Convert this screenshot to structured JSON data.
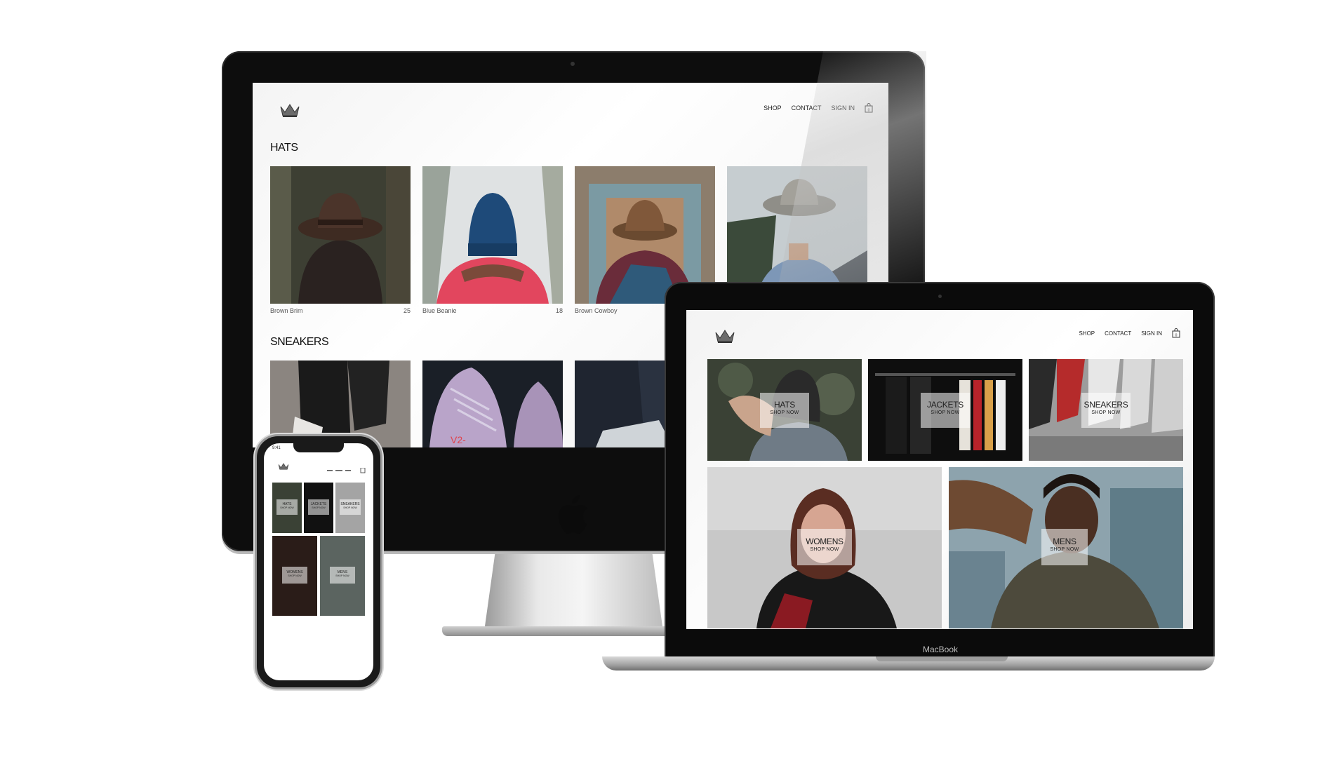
{
  "colors": {
    "accent": "#222222",
    "background": "#ffffff",
    "bezel": "#0d0d0d"
  },
  "imac": {
    "site": {
      "logo_icon": "crown-icon",
      "nav": {
        "shop": "SHOP",
        "contact": "CONTACT",
        "signin": "SIGN IN",
        "cart_icon": "shopping-bag-icon"
      },
      "sections": [
        {
          "title": "HATS",
          "products": [
            {
              "name": "Brown Brim",
              "price": "25"
            },
            {
              "name": "Blue Beanie",
              "price": "18"
            },
            {
              "name": "Brown Cowboy",
              "price": ""
            },
            {
              "name": "",
              "price": ""
            }
          ]
        },
        {
          "title": "SNEAKERS"
        }
      ]
    }
  },
  "macbook": {
    "label": "MacBook",
    "site": {
      "logo_icon": "crown-icon",
      "nav": {
        "shop": "SHOP",
        "contact": "CONTACT",
        "signin": "SIGN IN",
        "cart_icon": "shopping-bag-icon"
      },
      "categories": [
        {
          "title": "HATS",
          "subtitle": "SHOP NOW"
        },
        {
          "title": "JACKETS",
          "subtitle": "SHOP NOW"
        },
        {
          "title": "SNEAKERS",
          "subtitle": "SHOP NOW"
        },
        {
          "title": "WOMENS",
          "subtitle": "SHOP NOW"
        },
        {
          "title": "MENS",
          "subtitle": "SHOP NOW"
        }
      ]
    }
  },
  "iphone": {
    "status_time": "9:41",
    "site": {
      "logo_icon": "crown-icon",
      "categories": [
        {
          "title": "HATS",
          "subtitle": "SHOP NOW"
        },
        {
          "title": "JACKETS",
          "subtitle": "SHOP NOW"
        },
        {
          "title": "SNEAKERS",
          "subtitle": "SHOP NOW"
        },
        {
          "title": "WOMENS",
          "subtitle": "SHOP NOW"
        },
        {
          "title": "MENS",
          "subtitle": "SHOP NOW"
        }
      ]
    }
  }
}
